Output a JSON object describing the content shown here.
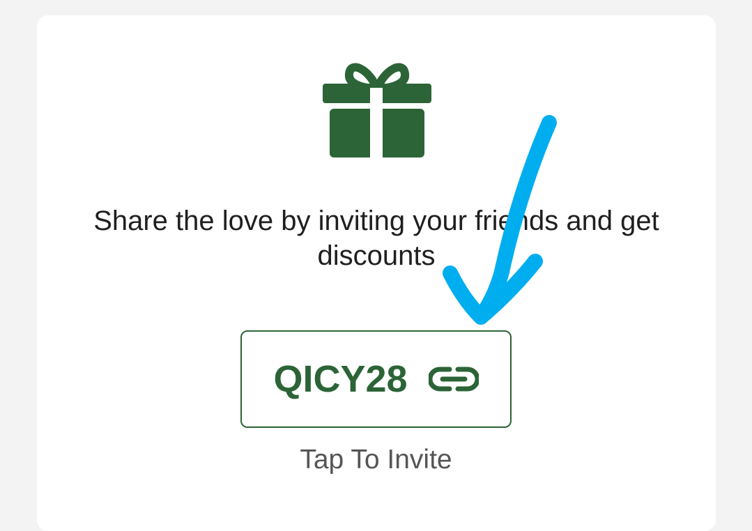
{
  "invite_card": {
    "message": "Share the love by inviting your friends and get discounts",
    "referral_code": "QICY28",
    "cta_label": "Tap To Invite"
  },
  "icons": {
    "gift": "gift-icon",
    "copy_link": "link-icon",
    "annotation": "hand-drawn-arrow"
  },
  "colors": {
    "brand_green": "#2c6437",
    "annotation_blue": "#00aef0",
    "background": "#f3f3f3"
  }
}
